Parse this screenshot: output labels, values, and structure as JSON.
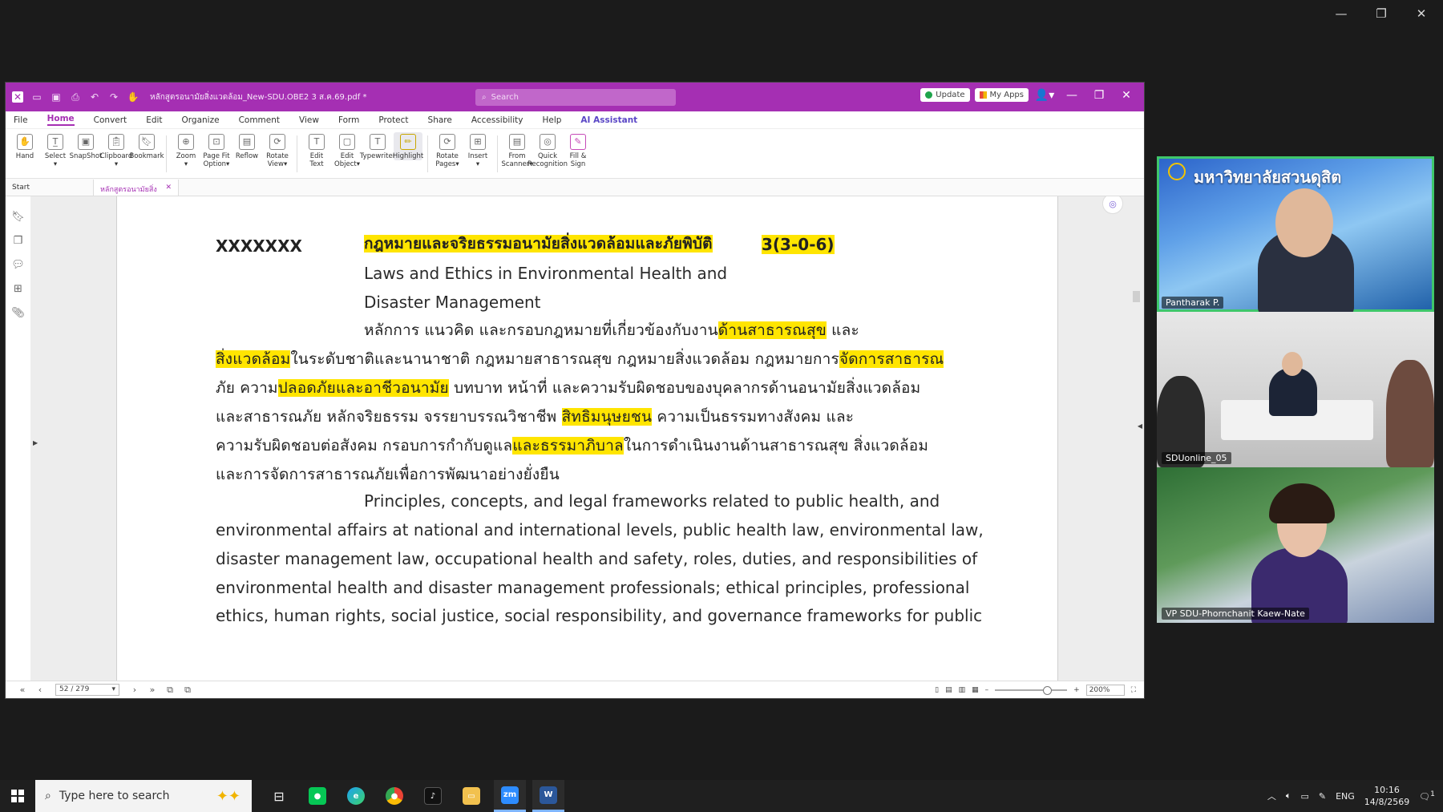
{
  "outer_window": {
    "minimize": "—",
    "restore": "❐",
    "close": "✕"
  },
  "app": {
    "doc_title": "หลักสูตรอนามัยสิ่งแวดล้อม_New-SDU.OBE2 3 ส.ค.69.pdf *",
    "search_placeholder": "Search",
    "update_label": "Update",
    "myapps_label": "My Apps",
    "menu": [
      "File",
      "Home",
      "Convert",
      "Edit",
      "Organize",
      "Comment",
      "View",
      "Form",
      "Protect",
      "Share",
      "Accessibility",
      "Help",
      "AI Assistant"
    ],
    "active_menu": "Home",
    "tools": [
      {
        "l1": "Hand",
        "l2": ""
      },
      {
        "l1": "Select",
        "l2": "▾"
      },
      {
        "l1": "SnapShot",
        "l2": ""
      },
      {
        "l1": "Clipboard",
        "l2": "▾"
      },
      {
        "l1": "Bookmark",
        "l2": ""
      },
      {
        "l1": "Zoom",
        "l2": "▾"
      },
      {
        "l1": "Page Fit",
        "l2": "Option▾"
      },
      {
        "l1": "Reflow",
        "l2": ""
      },
      {
        "l1": "Rotate",
        "l2": "View▾"
      },
      {
        "l1": "Edit",
        "l2": "Text"
      },
      {
        "l1": "Edit",
        "l2": "Object▾"
      },
      {
        "l1": "Typewriter",
        "l2": ""
      },
      {
        "l1": "Highlight",
        "l2": ""
      },
      {
        "l1": "Rotate",
        "l2": "Pages▾"
      },
      {
        "l1": "Insert",
        "l2": "▾"
      },
      {
        "l1": "From",
        "l2": "Scanner▾"
      },
      {
        "l1": "Quick",
        "l2": "Recognition"
      },
      {
        "l1": "Fill &",
        "l2": "Sign"
      }
    ],
    "tabs": {
      "start": "Start",
      "doc": "หลักสูตรอนามัยสิ่งแวดล้อ..."
    },
    "status": {
      "page": "52 / 279",
      "zoom": "200%"
    }
  },
  "document": {
    "course_code": "XXXXXXX",
    "course_name_th": "กฎหมายและจริยธรรมอนามัยสิ่งแวดล้อมและภัยพิบัติ",
    "credits": "3(3-0-6)",
    "course_name_en_1": "Laws and Ethics in Environmental Health and",
    "course_name_en_2": "Disaster Management",
    "th_lines": [
      [
        {
          "t": "หลักการ แนวคิด และกรอบกฎหมายที่เกี่ยวข้องกับงาน",
          "h": false
        },
        {
          "t": "ด้านสาธารณสุข",
          "h": true
        },
        {
          "t": " และ",
          "h": false
        }
      ],
      [
        {
          "t": "สิ่งแวดล้อม",
          "h": true
        },
        {
          "t": "ในระดับชาติและนานาชาติ กฎหมายสาธารณสุข กฎหมายสิ่งแวดล้อม กฎหมายการ",
          "h": false
        },
        {
          "t": "จัดการสาธารณ",
          "h": true
        }
      ],
      [
        {
          "t": "ภัย ความ",
          "h": false
        },
        {
          "t": "ปลอดภัยและอาชีวอนามัย",
          "h": true
        },
        {
          "t": " บทบาท หน้าที่ และความรับผิดชอบของบุคลากรด้านอนามัยสิ่งแวดล้อม",
          "h": false
        }
      ],
      [
        {
          "t": "และสาธารณภัย หลักจริยธรรม จรรยาบรรณวิชาชีพ ",
          "h": false
        },
        {
          "t": "สิทธิมนุษยชน",
          "h": true
        },
        {
          "t": " ความเป็นธรรมทางสังคม และ",
          "h": false
        }
      ],
      [
        {
          "t": "ความรับผิดชอบต่อสังคม กรอบการกำกับดูแล",
          "h": false
        },
        {
          "t": "และธรรมาภิบาล",
          "h": true
        },
        {
          "t": "ในการดำเนินงานด้านสาธารณสุข สิ่งแวดล้อม",
          "h": false
        }
      ],
      [
        {
          "t": "และการจัดการสาธารณภัยเพื่อการพัฒนาอย่างยั่งยืน",
          "h": false
        }
      ]
    ],
    "en_lines": [
      "Principles, concepts, and legal frameworks related to public health, and",
      "environmental affairs at national and international levels, public health law, environmental law,",
      "disaster management law, occupational health and safety, roles, duties, and responsibilities of",
      "environmental health and disaster management professionals; ethical principles, professional",
      "ethics, human rights, social justice, social responsibility, and governance frameworks for public"
    ]
  },
  "participants": [
    {
      "name": "Pantharak P.",
      "banner": "มหาวิทยาลัยสวนดุสิต"
    },
    {
      "name": "SDUonline_05"
    },
    {
      "name": "VP SDU-Phornchanit Kaew-Nate"
    }
  ],
  "taskbar": {
    "search_placeholder": "Type here to search",
    "lang": "ENG",
    "time": "10:16",
    "date": "14/8/2569",
    "notifications": "1"
  },
  "colors": {
    "accent": "#a52fb3",
    "highlight": "#ffe500",
    "speaker": "#3fc76b"
  }
}
